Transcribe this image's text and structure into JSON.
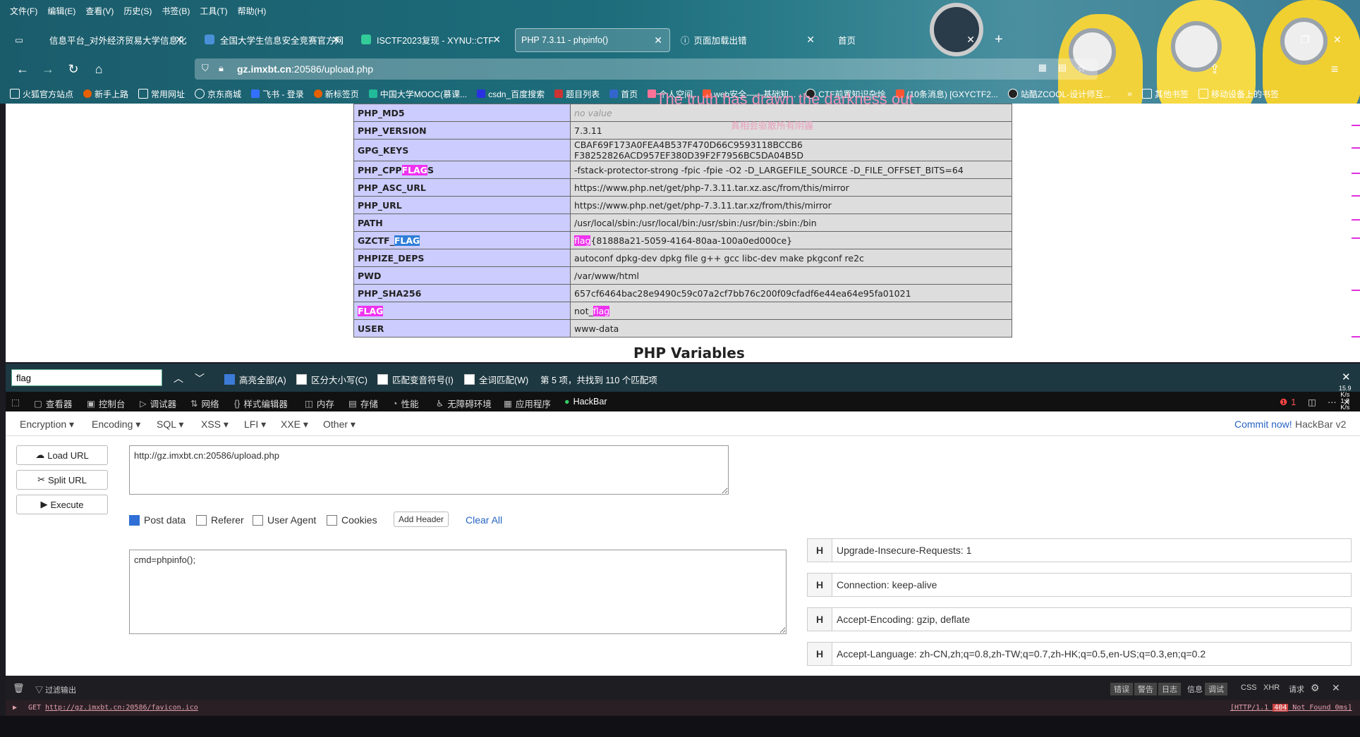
{
  "menu": [
    "文件(F)",
    "编辑(E)",
    "查看(V)",
    "历史(S)",
    "书签(B)",
    "工具(T)",
    "帮助(H)"
  ],
  "tabs": [
    {
      "label": "信息平台_对外经济贸易大学信息化"
    },
    {
      "label": "全国大学生信息安全竞赛官方网"
    },
    {
      "label": "ISCTF2023复现 - XYNU::CTF"
    },
    {
      "label": "PHP 7.3.11 - phpinfo()",
      "active": true
    },
    {
      "label": "页面加载出错"
    },
    {
      "label": "首页"
    }
  ],
  "url": {
    "host": "gz.imxbt.cn",
    "rest": ":20586/upload.php"
  },
  "bookmarks": [
    "火狐官方站点",
    "新手上路",
    "常用网址",
    "京东商城",
    "飞书 - 登录",
    "新标签页",
    "中国大学MOOC(慕课...",
    "csdn_百度搜索",
    "题目列表",
    "首页",
    "个人空间",
    "web安全——基础知...",
    "CTF前置知识杂烩",
    "(10条消息) [GXYCTF2...",
    "站酷ZCOOL-设计师互...",
    "其他书签",
    "移动设备上的书签"
  ],
  "watermark": {
    "line1": "The truth has drawn the darkness out",
    "line2": "真相会驱散所有阴霾"
  },
  "php_rows": [
    {
      "key": "PHP_MD5",
      "value": "no value",
      "empty": true
    },
    {
      "key": "PHP_VERSION",
      "value": "7.3.11"
    },
    {
      "key": "GPG_KEYS",
      "value": "CBAF69F173A0FEA4B537F470D66C9593118BCCB6 F38252826ACD957EF380D39F2F7956BC5DA04B5D"
    },
    {
      "key": "PHP_CPPFLAGS",
      "key_parts": [
        "PHP_CPP",
        "FLAG",
        "S"
      ],
      "value": "-fstack-protector-strong -fpic -fpie -O2 -D_LARGEFILE_SOURCE -D_FILE_OFFSET_BITS=64"
    },
    {
      "key": "PHP_ASC_URL",
      "value": "https://www.php.net/get/php-7.3.11.tar.xz.asc/from/this/mirror"
    },
    {
      "key": "PHP_URL",
      "value": "https://www.php.net/get/php-7.3.11.tar.xz/from/this/mirror"
    },
    {
      "key": "PATH",
      "value": "/usr/local/sbin:/usr/local/bin:/usr/sbin:/usr/bin:/sbin:/bin"
    },
    {
      "key": "GZCTF_FLAG",
      "key_parts": [
        "GZCTF_",
        "FLAG",
        ""
      ],
      "value_parts": [
        "flag",
        "{81888a21-5059-4164-80aa-100a0ed000ce}"
      ]
    },
    {
      "key": "PHPIZE_DEPS",
      "value": "autoconf dpkg-dev dpkg file g++ gcc libc-dev make pkgconf re2c"
    },
    {
      "key": "PWD",
      "value": "/var/www/html"
    },
    {
      "key": "PHP_SHA256",
      "value": "657cf6464bac28e9490c59c07a2cf7bb76c200f09cfadf6e44ea64e95fa01021"
    },
    {
      "key": "FLAG",
      "key_parts": [
        "",
        "FLAG",
        ""
      ],
      "value_parts": [
        "not_",
        "flag"
      ]
    },
    {
      "key": "USER",
      "value": "www-data"
    }
  ],
  "section_title": "PHP Variables",
  "findbar": {
    "query": "flag",
    "highlight_all": "高亮全部(A)",
    "match_case": "区分大小写(C)",
    "match_diacritics": "匹配变音符号(I)",
    "whole_words": "全词匹配(W)",
    "status": "第 5 项，共找到 110 个匹配项"
  },
  "devtools_tabs": [
    "查看器",
    "控制台",
    "调试器",
    "网络",
    "样式编辑器",
    "内存",
    "存储",
    "性能",
    "无障碍环境",
    "应用程序",
    "HackBar"
  ],
  "error_count": "1",
  "side_stats": [
    "15.9",
    "K/s",
    "1.8",
    "K/s"
  ],
  "hackbar": {
    "menu": [
      "Encryption",
      "Encoding",
      "SQL",
      "XSS",
      "LFI",
      "XXE",
      "Other"
    ],
    "commit_link": "Commit now!",
    "version": "HackBar v2",
    "load_url": "Load URL",
    "split_url": "Split URL",
    "execute": "Execute",
    "url_value": "http://gz.imxbt.cn:20586/upload.php",
    "post_data": "Post data",
    "referer": "Referer",
    "user_agent": "User Agent",
    "cookies": "Cookies",
    "add_header": "Add Header",
    "clear_all": "Clear All",
    "body_value": "cmd=phpinfo();",
    "headers": [
      "Upgrade-Insecure-Requests: 1",
      "Connection: keep-alive",
      "Accept-Encoding: gzip, deflate",
      "Accept-Language: zh-CN,zh;q=0.8,zh-TW;q=0.7,zh-HK;q=0.5,en-US;q=0.3,en;q=0.2"
    ]
  },
  "console": {
    "filter_placeholder": "过滤输出",
    "filters": [
      "错误",
      "警告",
      "日志",
      "信息",
      "调试",
      "CSS",
      "XHR",
      "请求"
    ],
    "log_method": "GET",
    "log_url": "http://gz.imxbt.cn:20586/favicon.ico",
    "log_status_prefix": "[HTTP/1.1 ",
    "log_status_code": "404",
    "log_status_suffix": " Not Found 0ms]"
  },
  "colors": {
    "find_highlight": "#ef32ef",
    "find_selected": "#2f7fd9",
    "key_bg": "#ccccff",
    "value_bg": "#dddddd"
  }
}
